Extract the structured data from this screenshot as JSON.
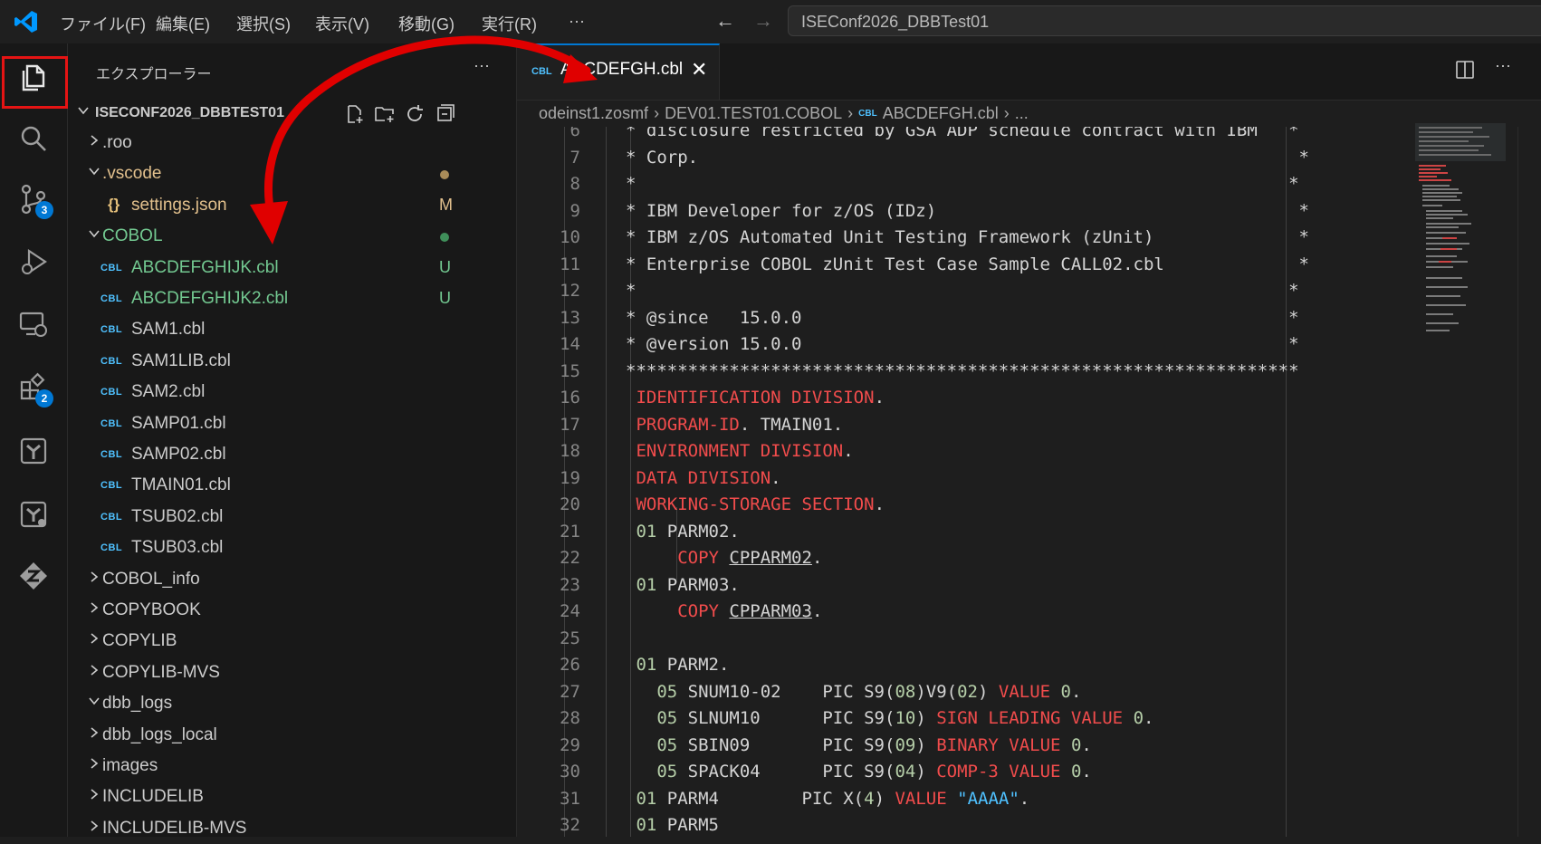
{
  "titlebar": {
    "menus": [
      "ファイル(F)",
      "編集(E)",
      "選択(S)",
      "表示(V)",
      "移動(G)",
      "実行(R)",
      "···"
    ],
    "search_text": "ISEConf2026_DBBTest01"
  },
  "activity_bar": {
    "items": [
      {
        "name": "explorer-icon",
        "badge": ""
      },
      {
        "name": "search-icon",
        "badge": ""
      },
      {
        "name": "source-control-icon",
        "badge": "3"
      },
      {
        "name": "run-debug-icon",
        "badge": ""
      },
      {
        "name": "remote-explorer-icon",
        "badge": ""
      },
      {
        "name": "extensions-icon",
        "badge": "2"
      },
      {
        "name": "ibm-z-icon",
        "badge": ""
      },
      {
        "name": "zowe-icon",
        "badge": ""
      },
      {
        "name": "z-open-editor-icon",
        "badge": ""
      }
    ]
  },
  "sidebar": {
    "title": "エクスプローラー",
    "more": "···",
    "workspace": "ISECONF2026_DBBTEST01",
    "tree": [
      {
        "label": ".roo",
        "kind": "folder",
        "expanded": false,
        "depth": 1,
        "color": "#cccccc",
        "status": "",
        "status_color": ""
      },
      {
        "label": ".vscode",
        "kind": "folder",
        "expanded": true,
        "depth": 1,
        "color": "#e2c08d",
        "status": "dot",
        "status_color": "#a98c59"
      },
      {
        "label": "settings.json",
        "kind": "json",
        "depth": 2,
        "color": "#e2c08d",
        "status": "M",
        "status_color": "#e2c08d"
      },
      {
        "label": "COBOL",
        "kind": "folder",
        "expanded": true,
        "depth": 1,
        "color": "#73c991",
        "status": "dot",
        "status_color": "#3f8f5a"
      },
      {
        "label": "ABCDEFGHIJK.cbl",
        "kind": "cbl",
        "depth": 2,
        "color": "#73c991",
        "status": "U",
        "status_color": "#73c991"
      },
      {
        "label": "ABCDEFGHIJK2.cbl",
        "kind": "cbl",
        "depth": 2,
        "color": "#73c991",
        "status": "U",
        "status_color": "#73c991"
      },
      {
        "label": "SAM1.cbl",
        "kind": "cbl",
        "depth": 2,
        "color": "#cccccc",
        "status": "",
        "status_color": ""
      },
      {
        "label": "SAM1LIB.cbl",
        "kind": "cbl",
        "depth": 2,
        "color": "#cccccc",
        "status": "",
        "status_color": ""
      },
      {
        "label": "SAM2.cbl",
        "kind": "cbl",
        "depth": 2,
        "color": "#cccccc",
        "status": "",
        "status_color": ""
      },
      {
        "label": "SAMP01.cbl",
        "kind": "cbl",
        "depth": 2,
        "color": "#cccccc",
        "status": "",
        "status_color": ""
      },
      {
        "label": "SAMP02.cbl",
        "kind": "cbl",
        "depth": 2,
        "color": "#cccccc",
        "status": "",
        "status_color": ""
      },
      {
        "label": "TMAIN01.cbl",
        "kind": "cbl",
        "depth": 2,
        "color": "#cccccc",
        "status": "",
        "status_color": ""
      },
      {
        "label": "TSUB02.cbl",
        "kind": "cbl",
        "depth": 2,
        "color": "#cccccc",
        "status": "",
        "status_color": ""
      },
      {
        "label": "TSUB03.cbl",
        "kind": "cbl",
        "depth": 2,
        "color": "#cccccc",
        "status": "",
        "status_color": ""
      },
      {
        "label": "COBOL_info",
        "kind": "folder",
        "expanded": false,
        "depth": 1,
        "color": "#cccccc",
        "status": "",
        "status_color": ""
      },
      {
        "label": "COPYBOOK",
        "kind": "folder",
        "expanded": false,
        "depth": 1,
        "color": "#cccccc",
        "status": "",
        "status_color": ""
      },
      {
        "label": "COPYLIB",
        "kind": "folder",
        "expanded": false,
        "depth": 1,
        "color": "#cccccc",
        "status": "",
        "status_color": ""
      },
      {
        "label": "COPYLIB-MVS",
        "kind": "folder",
        "expanded": false,
        "depth": 1,
        "color": "#cccccc",
        "status": "",
        "status_color": ""
      },
      {
        "label": "dbb_logs",
        "kind": "folder",
        "expanded": true,
        "depth": 1,
        "color": "#cccccc",
        "status": "",
        "status_color": ""
      },
      {
        "label": "dbb_logs_local",
        "kind": "folder",
        "expanded": false,
        "depth": 1,
        "color": "#cccccc",
        "status": "",
        "status_color": ""
      },
      {
        "label": "images",
        "kind": "folder",
        "expanded": false,
        "depth": 1,
        "color": "#cccccc",
        "status": "",
        "status_color": ""
      },
      {
        "label": "INCLUDELIB",
        "kind": "folder",
        "expanded": false,
        "depth": 1,
        "color": "#cccccc",
        "status": "",
        "status_color": ""
      },
      {
        "label": "INCLUDELIB-MVS",
        "kind": "folder",
        "expanded": false,
        "depth": 1,
        "color": "#cccccc",
        "status": "",
        "status_color": ""
      }
    ]
  },
  "editor": {
    "tab_icon": "CBL",
    "tab_label": "ABCDEFGH.cbl",
    "tab_close": "✕",
    "more": "···",
    "breadcrumb": [
      "odeinst1.zosmf",
      "DEV01.TEST01.COBOL",
      "ABCDEFGH.cbl",
      "..."
    ],
    "lines": [
      {
        "n": "6",
        "segs": [
          [
            "t",
            "* disclosure restricted by GSA ADP schedule contract with IBM   *"
          ]
        ]
      },
      {
        "n": "7",
        "segs": [
          [
            "t",
            "* Corp.                                                          *"
          ]
        ]
      },
      {
        "n": "8",
        "segs": [
          [
            "t",
            "*                                                               *"
          ]
        ]
      },
      {
        "n": "9",
        "segs": [
          [
            "t",
            "* IBM Developer for z/OS (IDz)                                   *"
          ]
        ]
      },
      {
        "n": "10",
        "segs": [
          [
            "t",
            "* IBM z/OS Automated Unit Testing Framework (zUnit)              *"
          ]
        ]
      },
      {
        "n": "11",
        "segs": [
          [
            "t",
            "* Enterprise COBOL zUnit Test Case Sample CALL02.cbl             *"
          ]
        ]
      },
      {
        "n": "12",
        "segs": [
          [
            "t",
            "*                                                               *"
          ]
        ]
      },
      {
        "n": "13",
        "segs": [
          [
            "t",
            "* @since   15.0.0                                               *"
          ]
        ]
      },
      {
        "n": "14",
        "segs": [
          [
            "t",
            "* @version 15.0.0                                               *"
          ]
        ]
      },
      {
        "n": "15",
        "segs": [
          [
            "t",
            "*****************************************************************"
          ]
        ]
      },
      {
        "n": "16",
        "segs": [
          [
            "t",
            " "
          ],
          [
            "k",
            "IDENTIFICATION DIVISION"
          ],
          [
            "t",
            "."
          ]
        ]
      },
      {
        "n": "17",
        "segs": [
          [
            "t",
            " "
          ],
          [
            "k",
            "PROGRAM-ID"
          ],
          [
            "t",
            ". TMAIN01."
          ]
        ]
      },
      {
        "n": "18",
        "segs": [
          [
            "t",
            " "
          ],
          [
            "k",
            "ENVIRONMENT DIVISION"
          ],
          [
            "t",
            "."
          ]
        ]
      },
      {
        "n": "19",
        "segs": [
          [
            "t",
            " "
          ],
          [
            "k",
            "DATA DIVISION"
          ],
          [
            "t",
            "."
          ]
        ]
      },
      {
        "n": "20",
        "segs": [
          [
            "t",
            " "
          ],
          [
            "k",
            "WORKING-STORAGE SECTION"
          ],
          [
            "t",
            "."
          ]
        ]
      },
      {
        "n": "21",
        "segs": [
          [
            "t",
            " "
          ],
          [
            "n",
            "01"
          ],
          [
            "t",
            " PARM02."
          ]
        ]
      },
      {
        "n": "22",
        "segs": [
          [
            "t",
            "     "
          ],
          [
            "k",
            "COPY"
          ],
          [
            "t",
            " "
          ],
          [
            "u",
            "CPPARM02"
          ],
          [
            "t",
            "."
          ]
        ]
      },
      {
        "n": "23",
        "segs": [
          [
            "t",
            " "
          ],
          [
            "n",
            "01"
          ],
          [
            "t",
            " PARM03."
          ]
        ]
      },
      {
        "n": "24",
        "segs": [
          [
            "t",
            "     "
          ],
          [
            "k",
            "COPY"
          ],
          [
            "t",
            " "
          ],
          [
            "u",
            "CPPARM03"
          ],
          [
            "t",
            "."
          ]
        ]
      },
      {
        "n": "25",
        "segs": [
          [
            "t",
            ""
          ]
        ]
      },
      {
        "n": "26",
        "segs": [
          [
            "t",
            " "
          ],
          [
            "n",
            "01"
          ],
          [
            "t",
            " PARM2."
          ]
        ]
      },
      {
        "n": "27",
        "segs": [
          [
            "t",
            "   "
          ],
          [
            "n",
            "05"
          ],
          [
            "t",
            " SNUM10-02    PIC S9("
          ],
          [
            "n",
            "08"
          ],
          [
            "t",
            ")V9("
          ],
          [
            "n",
            "02"
          ],
          [
            "t",
            ") "
          ],
          [
            "k",
            "VALUE"
          ],
          [
            "t",
            " "
          ],
          [
            "n",
            "0"
          ],
          [
            "t",
            "."
          ]
        ]
      },
      {
        "n": "28",
        "segs": [
          [
            "t",
            "   "
          ],
          [
            "n",
            "05"
          ],
          [
            "t",
            " SLNUM10      PIC S9("
          ],
          [
            "n",
            "10"
          ],
          [
            "t",
            ") "
          ],
          [
            "k",
            "SIGN LEADING VALUE"
          ],
          [
            "t",
            " "
          ],
          [
            "n",
            "0"
          ],
          [
            "t",
            "."
          ]
        ]
      },
      {
        "n": "29",
        "segs": [
          [
            "t",
            "   "
          ],
          [
            "n",
            "05"
          ],
          [
            "t",
            " SBIN09       PIC S9("
          ],
          [
            "n",
            "09"
          ],
          [
            "t",
            ") "
          ],
          [
            "k",
            "BINARY VALUE"
          ],
          [
            "t",
            " "
          ],
          [
            "n",
            "0"
          ],
          [
            "t",
            "."
          ]
        ]
      },
      {
        "n": "30",
        "segs": [
          [
            "t",
            "   "
          ],
          [
            "n",
            "05"
          ],
          [
            "t",
            " SPACK04      PIC S9("
          ],
          [
            "n",
            "04"
          ],
          [
            "t",
            ") "
          ],
          [
            "k",
            "COMP-3 VALUE"
          ],
          [
            "t",
            " "
          ],
          [
            "n",
            "0"
          ],
          [
            "t",
            "."
          ]
        ]
      },
      {
        "n": "31",
        "segs": [
          [
            "t",
            " "
          ],
          [
            "n",
            "01"
          ],
          [
            "t",
            " PARM4        PIC X("
          ],
          [
            "n",
            "4"
          ],
          [
            "t",
            ") "
          ],
          [
            "k",
            "VALUE"
          ],
          [
            "t",
            " "
          ],
          [
            "s",
            "\"AAAA\""
          ],
          [
            "t",
            "."
          ]
        ]
      },
      {
        "n": "32",
        "segs": [
          [
            "t",
            " "
          ],
          [
            "n",
            "01"
          ],
          [
            "t",
            " PARM5"
          ]
        ]
      }
    ]
  },
  "annotation": {
    "highlight_color": "#e51414",
    "arrow_color": "#e00000"
  }
}
